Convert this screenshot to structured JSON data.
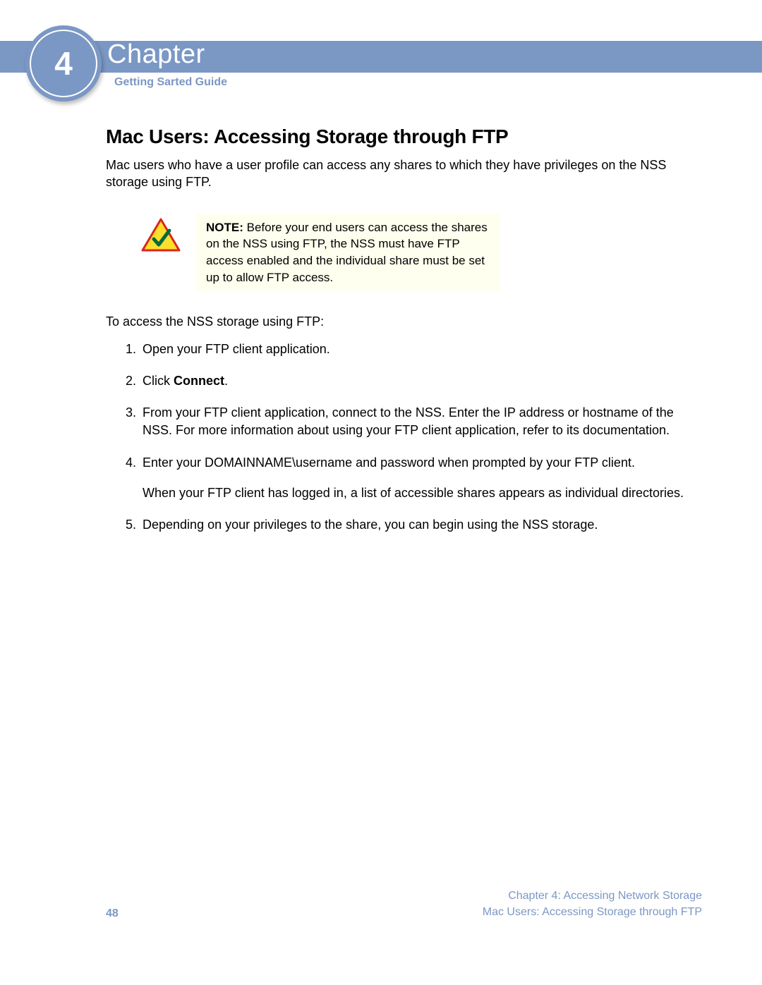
{
  "header": {
    "chapter_label": "Chapter",
    "chapter_number": "4",
    "guide_label": "Getting Sarted Guide"
  },
  "section": {
    "title": "Mac Users: Accessing Storage through FTP",
    "intro": "Mac users who have a user profile can access any shares to which they have privileges on the NSS storage using FTP."
  },
  "note": {
    "label": "NOTE:",
    "text": "Before your end users can access the shares on the NSS using FTP, the NSS must have FTP access enabled and the individual share must be set up to allow FTP access."
  },
  "lead": "To access the NSS storage using FTP:",
  "steps": {
    "s1": "Open your FTP client application.",
    "s2_prefix": "Click ",
    "s2_bold": "Connect",
    "s2_suffix": ".",
    "s3": "From your FTP client application, connect to the NSS. Enter the IP address or hostname of the NSS. For more information about using your FTP client application, refer to its documentation.",
    "s4": "Enter your DOMAINNAME\\username and password when prompted by your FTP client.",
    "s4_extra": "When your FTP client has logged in, a list of accessible shares appears as individual directories.",
    "s5": "Depending on your privileges to the share, you can begin using the NSS storage."
  },
  "footer": {
    "page_number": "48",
    "chapter_line": "Chapter 4: Accessing Network Storage",
    "section_line": "Mac Users: Accessing Storage through FTP"
  }
}
